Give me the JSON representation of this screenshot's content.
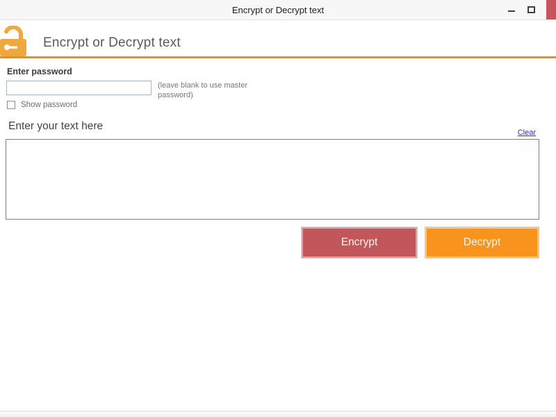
{
  "window": {
    "title": "Encrypt or Decrypt text",
    "controls": {
      "minimize_icon": "minimize-dash",
      "maximize_icon": "maximize-square",
      "close_icon": "close-red-block"
    }
  },
  "header": {
    "title": "Encrypt or Decrypt text",
    "icon": "open-padlock-icon"
  },
  "password_section": {
    "label": "Enter password",
    "input_value": "",
    "hint": "(leave blank to use master password)",
    "show_password_label": "Show password",
    "show_password_checked": false
  },
  "text_section": {
    "label": "Enter your text here",
    "clear_label": "Clear",
    "textarea_value": ""
  },
  "actions": {
    "encrypt_label": "Encrypt",
    "decrypt_label": "Decrypt"
  },
  "colors": {
    "accent_orange": "#EC9106",
    "lock_orange": "#F0A73B",
    "encrypt_red": "#C2575B",
    "decrypt_orange": "#F8941D",
    "close_red": "#C9535A",
    "link_blue": "#2E2EBF",
    "heading_gray": "#58595B"
  }
}
